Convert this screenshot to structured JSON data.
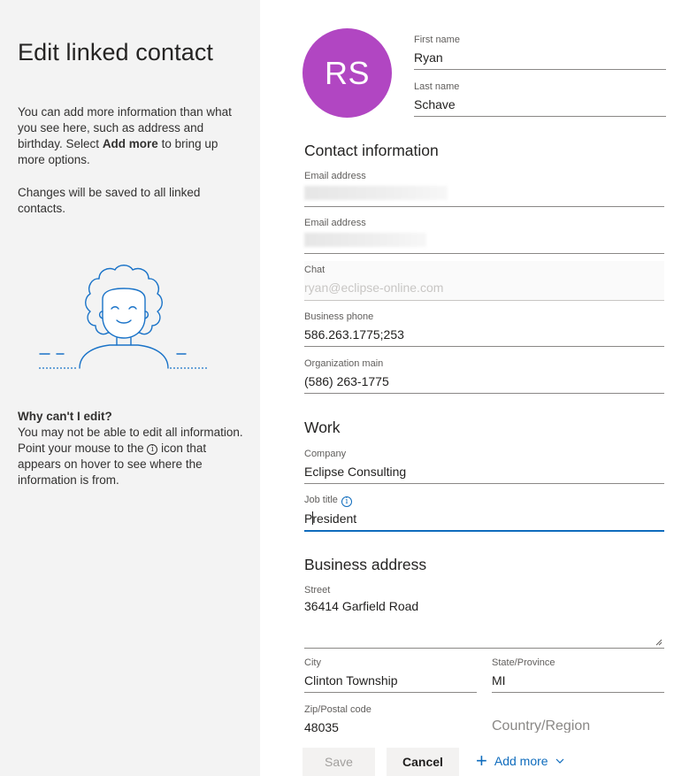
{
  "sidebar": {
    "title": "Edit linked contact",
    "intro_pre": "You can add more information than what you see here, such as address and birthday. Select ",
    "intro_bold": "Add more",
    "intro_post": " to bring up more options.",
    "saved_note": "Changes will be saved to all linked contacts.",
    "why_title": "Why can't I edit?",
    "why_text_1": "You may not be able to edit all information. Point your mouse to the ",
    "why_icon": "i",
    "why_text_2": " icon that appears on hover to see where the information is from."
  },
  "contact": {
    "initials": "RS",
    "avatar_color": "#b146c2",
    "first_name_label": "First name",
    "first_name": "Ryan",
    "last_name_label": "Last name",
    "last_name": "Schave"
  },
  "contact_info": {
    "heading": "Contact information",
    "email1_label": "Email address",
    "email2_label": "Email address",
    "chat_label": "Chat",
    "chat_value": "ryan@eclipse-online.com",
    "business_phone_label": "Business phone",
    "business_phone": "586.263.1775;253",
    "org_main_label": "Organization main",
    "org_main": "(586) 263-1775"
  },
  "work": {
    "heading": "Work",
    "company_label": "Company",
    "company": "Eclipse Consulting",
    "job_title_label": "Job title",
    "job_title_first": "P",
    "job_title_rest": "resident"
  },
  "business_address": {
    "heading": "Business address",
    "street_label": "Street",
    "street": "36414 Garfield Road",
    "city_label": "City",
    "city": "Clinton Township",
    "state_label": "State/Province",
    "state": "MI",
    "zip_label": "Zip/Postal code",
    "zip": "48035",
    "country_placeholder": "Country/Region"
  },
  "footer": {
    "save_label": "Save",
    "cancel_label": "Cancel",
    "add_more_label": "Add more"
  },
  "colors": {
    "accent": "#0f6cbd",
    "sidebar_bg": "#f3f3f3"
  }
}
